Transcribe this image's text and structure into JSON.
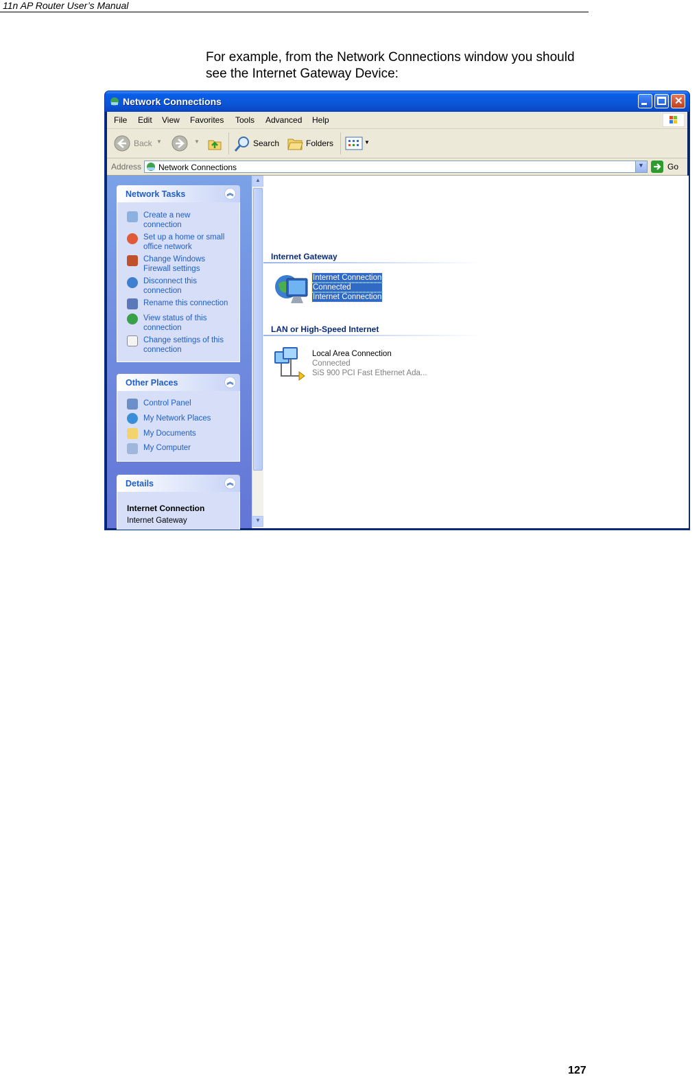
{
  "document": {
    "running_header": "11n AP Router User’s Manual",
    "intro_line1": "For example, from the Network Connections window you should",
    "intro_line2": "see the Internet Gateway Device:",
    "page_number": "127"
  },
  "window": {
    "title": "Network Connections",
    "menu": [
      "File",
      "Edit",
      "View",
      "Favorites",
      "Tools",
      "Advanced",
      "Help"
    ],
    "toolbar": {
      "back": "Back",
      "search": "Search",
      "folders": "Folders"
    },
    "address": {
      "label": "Address",
      "value": "Network Connections",
      "go": "Go"
    }
  },
  "sidebar": {
    "network_tasks": {
      "title": "Network Tasks",
      "items": [
        {
          "line1": "Create a new",
          "line2": "connection"
        },
        {
          "line1": "Set up a home or small",
          "line2": "office network"
        },
        {
          "line1": "Change Windows",
          "line2": "Firewall settings"
        },
        {
          "line1": "Disconnect this",
          "line2": "connection"
        },
        {
          "line1": "Rename this connection",
          "line2": ""
        },
        {
          "line1": "View status of this",
          "line2": "connection"
        },
        {
          "line1": "Change settings of this",
          "line2": "connection"
        }
      ]
    },
    "other_places": {
      "title": "Other Places",
      "items": [
        "Control Panel",
        "My Network Places",
        "My Documents",
        "My Computer"
      ]
    },
    "details": {
      "title": "Details",
      "name": "Internet Connection",
      "type": "Internet Gateway"
    }
  },
  "main": {
    "group1": {
      "title": "Internet Gateway",
      "item": {
        "name": "Internet Connection",
        "status": "Connected",
        "device": "Internet Connection"
      }
    },
    "group2": {
      "title": "LAN or High-Speed Internet",
      "item": {
        "name": "Local Area Connection",
        "status": "Connected",
        "device": "SiS 900 PCI Fast Ethernet Ada..."
      }
    }
  },
  "colors": {
    "title_bar": "#0a5ee8",
    "sidebar": "#7ba2e7",
    "selection": "#316ac5",
    "link": "#215dc6"
  }
}
